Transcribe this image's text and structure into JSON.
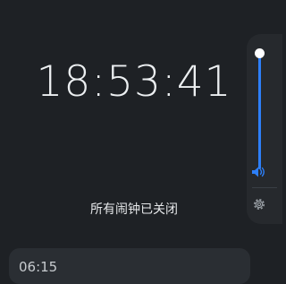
{
  "clock": {
    "time": "18:53:41"
  },
  "alarm_status": {
    "text": "所有闹钟已关闭"
  },
  "alarm_list": {
    "items": [
      {
        "time": "06:15"
      }
    ]
  },
  "volume_panel": {
    "level": 1.0,
    "accent_color": "#2d7ff9",
    "icons": {
      "volume": "speaker-volume-icon",
      "settings": "gear-icon"
    }
  }
}
